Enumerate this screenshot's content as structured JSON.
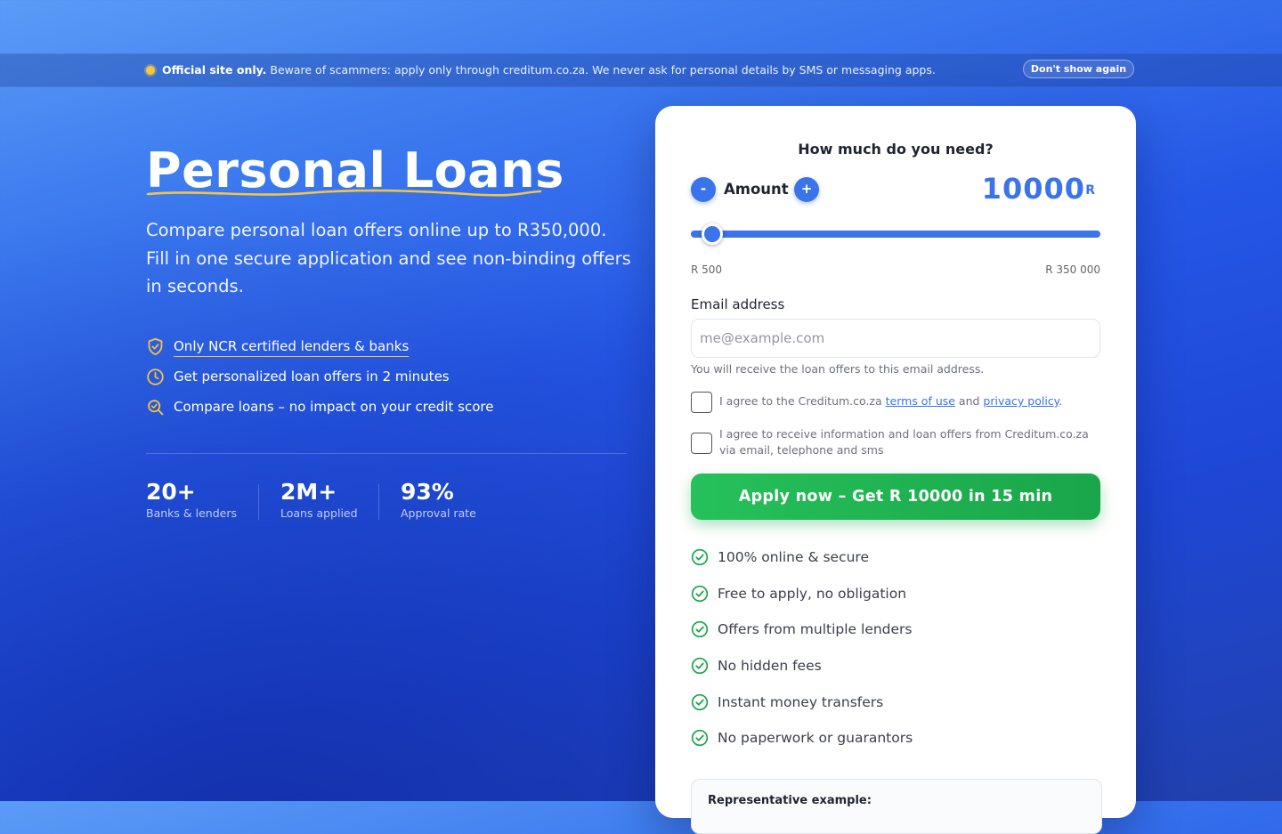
{
  "notice": {
    "bold": "Official site only.",
    "text": " Beware of scammers: apply only through creditum.co.za. We never ask for personal details by SMS or messaging apps.",
    "dismiss_label": "Don't show again"
  },
  "hero": {
    "title": "Personal Loans",
    "lead": "Compare personal loan offers online up to R350,000. Fill in one secure application and see non-binding offers in seconds.",
    "features": [
      {
        "icon": "shield-check-icon",
        "label": "Only NCR certified lenders & banks"
      },
      {
        "icon": "clock-icon",
        "label": "Get personalized loan offers in 2 minutes"
      },
      {
        "icon": "search-check-icon",
        "label": "Compare loans – no impact on your credit score"
      }
    ],
    "stats": [
      {
        "value": "20+",
        "label": "Banks & lenders"
      },
      {
        "value": "2M+",
        "label": "Loans applied"
      },
      {
        "value": "93%",
        "label": "Approval rate"
      }
    ]
  },
  "form": {
    "question": "How much do you need?",
    "minus_label": "-",
    "plus_label": "+",
    "amount_label": "Amount",
    "amount_value": "10000",
    "currency": "R",
    "range_min": "R 500",
    "range_max": "R 350 000",
    "email_label": "Email address",
    "email_placeholder": "me@example.com",
    "email_value": "",
    "email_hint": "You will receive the loan offers to this email address.",
    "consent_terms": {
      "before": "I agree to the Creditum.co.za ",
      "terms_link": "terms of use",
      "middle": " and ",
      "privacy_link": "privacy policy",
      "after": ".",
      "checked": false
    },
    "consent_marketing": {
      "text": "I agree to receive information and loan offers from Creditum.co.za via email, telephone and sms",
      "checked": false
    },
    "apply_label": "Apply now – Get R 10000 in 15 min",
    "benefits": [
      "100% online & secure",
      "Free to apply, no obligation",
      "Offers from multiple lenders",
      "No hidden fees",
      "Instant money transfers",
      "No paperwork or guarantors"
    ],
    "rep_example_title": "Representative example:"
  },
  "colors": {
    "accent": "#3b73ea",
    "success": "#1aa54a",
    "highlight": "#f5c542"
  }
}
